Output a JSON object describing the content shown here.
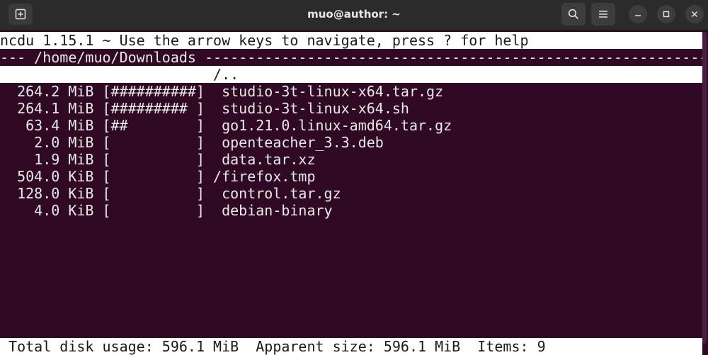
{
  "window": {
    "title": "muo@author: ~"
  },
  "icons": {
    "new_tab": "new-tab-icon",
    "search": "search-icon",
    "menu": "hamburger-menu-icon",
    "minimize": "minimize-icon",
    "maximize": "maximize-icon",
    "close": "close-icon"
  },
  "colors": {
    "terminal_bg": "#300a24",
    "terminal_fg": "#e8e8e8",
    "highlight_bg": "#ffffff",
    "titlebar_bg": "#2b2b2b"
  },
  "ncdu": {
    "header": "ncdu 1.15.1 ~ Use the arrow keys to navigate, press ? for help",
    "path_line": "--- /home/muo/Downloads --------------------------------------------------------------------",
    "parent_line": "                         /..",
    "rows": [
      {
        "text": "  264.2 MiB [##########]  studio-3t-linux-x64.tar.gz"
      },
      {
        "text": "  264.1 MiB [######### ]  studio-3t-linux-x64.sh"
      },
      {
        "text": "   63.4 MiB [##        ]  go1.21.0.linux-amd64.tar.gz"
      },
      {
        "text": "    2.0 MiB [          ]  openteacher_3.3.deb"
      },
      {
        "text": "    1.9 MiB [          ]  data.tar.xz"
      },
      {
        "text": "  504.0 KiB [          ] /firefox.tmp"
      },
      {
        "text": "  128.0 KiB [          ]  control.tar.gz"
      },
      {
        "text": "    4.0 KiB [          ]  debian-binary"
      }
    ],
    "status": " Total disk usage: 596.1 MiB  Apparent size: 596.1 MiB  Items: 9"
  }
}
